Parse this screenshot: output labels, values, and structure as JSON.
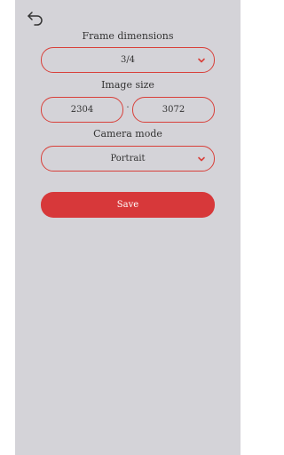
{
  "colors": {
    "accent": "#d8403a",
    "panel_background": "#d4d3d8",
    "save_button": "#d7383a"
  },
  "header": {
    "back_icon": "back-arrow-icon"
  },
  "frame_dimensions": {
    "label": "Frame dimensions",
    "selected": "3/4",
    "icon": "chevron-down-icon"
  },
  "image_size": {
    "label": "Image size",
    "width": "2304",
    "separator": "·",
    "height": "3072"
  },
  "camera_mode": {
    "label": "Camera mode",
    "selected": "Portrait",
    "icon": "chevron-down-icon"
  },
  "actions": {
    "save_label": "Save"
  }
}
